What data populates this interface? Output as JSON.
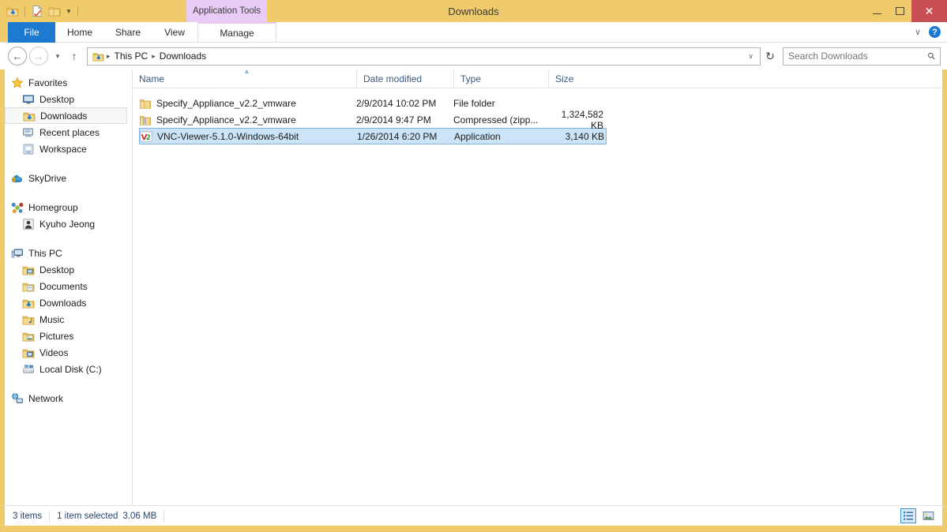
{
  "window": {
    "title": "Downloads",
    "contextual_tab": "Application Tools",
    "minimize_label": "Minimize",
    "maximize_label": "Maximize",
    "close_label": "✕"
  },
  "quick_access": {
    "items": [
      {
        "name": "downloads-folder-icon",
        "label": "Downloads"
      },
      {
        "name": "properties-icon",
        "label": "Properties"
      },
      {
        "name": "new-folder-icon",
        "label": "New folder"
      }
    ],
    "customize_chevron": "▾"
  },
  "ribbon": {
    "tabs": [
      {
        "label": "File",
        "key": "file"
      },
      {
        "label": "Home",
        "key": "home"
      },
      {
        "label": "Share",
        "key": "share"
      },
      {
        "label": "View",
        "key": "view"
      },
      {
        "label": "Manage",
        "key": "manage"
      }
    ],
    "collapse_chevron": "∨",
    "help_label": "?"
  },
  "address": {
    "back": "←",
    "forward": "→",
    "recent_chevron": "▾",
    "up": "↑",
    "breadcrumb": [
      "This PC",
      "Downloads"
    ],
    "breadcrumb_separator": "▸",
    "dropdown_chevron": "∨",
    "refresh": "↻"
  },
  "search": {
    "placeholder": "Search Downloads",
    "value": "",
    "icon": "search-icon"
  },
  "sidebar": {
    "groups": [
      {
        "root": {
          "label": "Favorites",
          "icon": "star-icon"
        },
        "items": [
          {
            "label": "Desktop",
            "icon": "monitor-icon",
            "selected": false
          },
          {
            "label": "Downloads",
            "icon": "downloads-folder-icon",
            "selected": true
          },
          {
            "label": "Recent places",
            "icon": "recent-places-icon",
            "selected": false
          },
          {
            "label": "Workspace",
            "icon": "workspace-icon",
            "selected": false
          }
        ]
      },
      {
        "root": {
          "label": "SkyDrive",
          "icon": "skydrive-icon"
        },
        "items": []
      },
      {
        "root": {
          "label": "Homegroup",
          "icon": "homegroup-icon"
        },
        "items": [
          {
            "label": "Kyuho Jeong",
            "icon": "user-icon",
            "selected": false
          }
        ]
      },
      {
        "root": {
          "label": "This PC",
          "icon": "computer-icon"
        },
        "items": [
          {
            "label": "Desktop",
            "icon": "desktop-folder-icon",
            "selected": false
          },
          {
            "label": "Documents",
            "icon": "documents-folder-icon",
            "selected": false
          },
          {
            "label": "Downloads",
            "icon": "downloads-folder-icon",
            "selected": false
          },
          {
            "label": "Music",
            "icon": "music-folder-icon",
            "selected": false
          },
          {
            "label": "Pictures",
            "icon": "pictures-folder-icon",
            "selected": false
          },
          {
            "label": "Videos",
            "icon": "videos-folder-icon",
            "selected": false
          },
          {
            "label": "Local Disk (C:)",
            "icon": "hard-disk-icon",
            "selected": false
          }
        ]
      },
      {
        "root": {
          "label": "Network",
          "icon": "network-icon"
        },
        "items": []
      }
    ]
  },
  "file_list": {
    "columns": [
      {
        "label": "Name",
        "key": "name",
        "sorted": true,
        "sort_direction": "asc"
      },
      {
        "label": "Date modified",
        "key": "date"
      },
      {
        "label": "Type",
        "key": "type"
      },
      {
        "label": "Size",
        "key": "size"
      }
    ],
    "sort_indicator": "▲",
    "rows": [
      {
        "name": "Specify_Appliance_v2.2_vmware",
        "date": "2/9/2014 10:02 PM",
        "type": "File folder",
        "size": "",
        "icon": "folder-icon",
        "selected": false
      },
      {
        "name": "Specify_Appliance_v2.2_vmware",
        "date": "2/9/2014 9:47 PM",
        "type": "Compressed (zipp...",
        "size": "1,324,582 KB",
        "icon": "zipped-folder-icon",
        "selected": false
      },
      {
        "name": "VNC-Viewer-5.1.0-Windows-64bit",
        "date": "1/26/2014 6:20 PM",
        "type": "Application",
        "size": "3,140 KB",
        "icon": "vnc-viewer-icon",
        "selected": true
      }
    ]
  },
  "status_bar": {
    "item_count": "3 items",
    "selection": "1 item selected",
    "selection_size": "3.06 MB",
    "view_buttons": [
      {
        "name": "details-view-button",
        "active": true
      },
      {
        "name": "large-icons-view-button",
        "active": false
      }
    ]
  },
  "colors": {
    "titlebar": "#efcb6b",
    "file_tab": "#1e7ad0",
    "contextual_tab": "#e9ccf6",
    "close_button": "#c85054",
    "selection": "#cce4f7",
    "selection_border": "#7eb4ea",
    "column_header_text": "#3d5a80"
  }
}
